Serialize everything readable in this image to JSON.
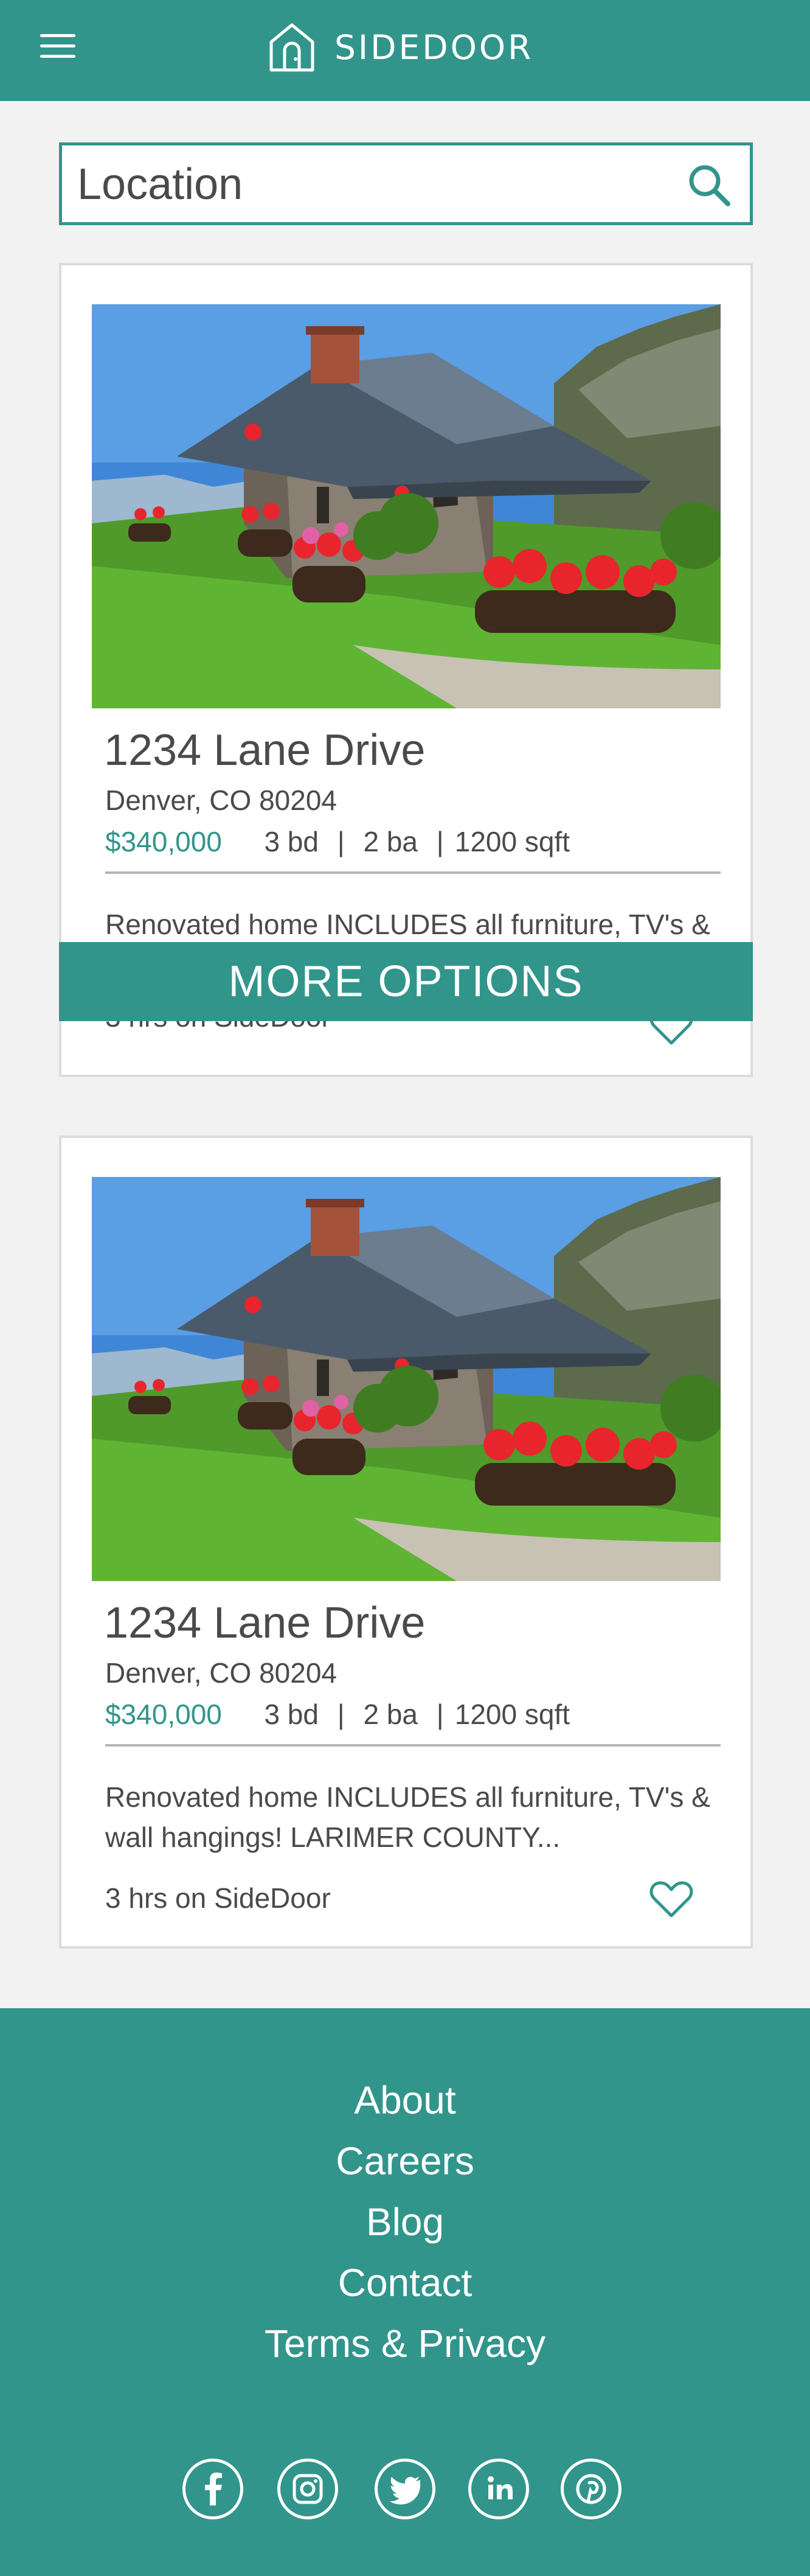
{
  "header": {
    "brand": "SIDEDOOR",
    "menu_icon": "hamburger-menu-icon",
    "logo_icon": "house-door-icon"
  },
  "search": {
    "placeholder": "Location",
    "icon": "search-icon"
  },
  "listings": [
    {
      "address": "1234 Lane Drive",
      "city": "Denver, CO 80204",
      "price": "$340,000",
      "beds": "3 bd",
      "baths": "2 ba",
      "sqft": "1200 sqft",
      "description": "Renovated home INCLUDES all furniture, TV's &",
      "listed": "3 hrs on SideDoor",
      "favorite_icon": "heart-icon"
    },
    {
      "address": "1234 Lane Drive",
      "city": "Denver, CO 80204",
      "price": "$340,000",
      "beds": "3 bd",
      "baths": "2 ba",
      "sqft": "1200 sqft",
      "description": "Renovated home INCLUDES all furniture, TV's & wall hangings! LARIMER COUNTY...",
      "listed": "3 hrs on SideDoor",
      "favorite_icon": "heart-icon"
    }
  ],
  "more_options": "MORE OPTIONS",
  "footer": {
    "links": [
      "About",
      "Careers",
      "Blog",
      "Contact",
      "Terms & Privacy"
    ],
    "social": [
      "facebook-icon",
      "instagram-icon",
      "twitter-icon",
      "linkedin-icon",
      "pinterest-icon"
    ]
  },
  "colors": {
    "brand": "#32958b",
    "background": "#f2f2f2",
    "text": "#4a4a4a"
  }
}
